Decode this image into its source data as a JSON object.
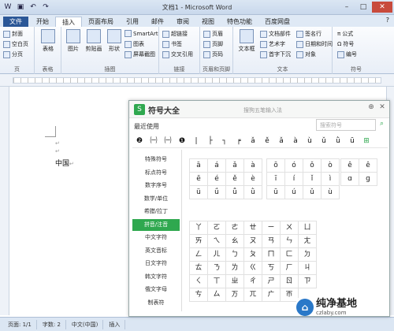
{
  "window": {
    "title": "文档1 - Microsoft Word"
  },
  "ribbon_tabs": [
    "文件",
    "开始",
    "插入",
    "页面布局",
    "引用",
    "邮件",
    "审阅",
    "视图",
    "特色功能",
    "百度网盘"
  ],
  "ribbon": {
    "groups": {
      "pages": "页",
      "table": "表格",
      "illus": "插图",
      "links": "链接",
      "hf": "页眉和页脚",
      "text": "文本",
      "symbols": "符号"
    },
    "cover": "封面",
    "blank": "空白页",
    "break": "分页",
    "table": "表格",
    "picture": "图片",
    "clipart": "剪贴画",
    "shapes": "形状",
    "smartart": "SmartArt",
    "chart": "图表",
    "screenshot": "屏幕截图",
    "hyperlink": "超链接",
    "bookmark": "书签",
    "crossref": "交叉引用",
    "header": "页眉",
    "footer": "页脚",
    "pagenum": "页码",
    "textbox": "文本框",
    "parts": "文档部件",
    "wordart": "艺术字",
    "dropcap": "首字下沉",
    "sigline": "签名行",
    "datetime": "日期和时间",
    "object": "对象",
    "equation": "公式",
    "symbol": "符号",
    "number": "编号"
  },
  "document": {
    "text": "中国"
  },
  "status": {
    "page": "页面: 1/1",
    "words": "字数: 2",
    "lang": "中文(中国)",
    "mode": "插入"
  },
  "panel": {
    "title": "符号大全",
    "subtitle": "搜狗五笔输入法",
    "recent_label": "最近使用",
    "search_placeholder": "搜索符号",
    "recent": [
      "❷",
      "㈠",
      "㈠",
      "❶",
      "|",
      "├",
      "┐",
      "╒",
      "ǎ",
      "ě",
      "ǎ",
      "à",
      "ù",
      "ǔ",
      "ǜ",
      "ū"
    ],
    "categories": [
      "特殊符号",
      "标点符号",
      "数字序号",
      "数学/单位",
      "希腊/拉丁",
      "拼音/注音",
      "中文字符",
      "英文音标",
      "日文字符",
      "韩文字符",
      "俄文字母",
      "制表符"
    ],
    "active_category": "拼音/注音",
    "pinyin_a": [
      "ā",
      "á",
      "ǎ",
      "à",
      "ē",
      "é",
      "ě",
      "è",
      "ü",
      "ǘ",
      "ǚ",
      "ǜ"
    ],
    "pinyin_o": [
      "ō",
      "ó",
      "ǒ",
      "ò",
      "ī",
      "í",
      "ǐ",
      "ì",
      "ū",
      "ú",
      "ǔ",
      "ù"
    ],
    "pinyin_e": [
      "ê",
      "ê",
      "ɑ",
      "ɡ"
    ],
    "zhuyin": [
      "丫",
      "ㄛ",
      "ㄜ",
      "ㄝ",
      "ㄧ",
      "ㄨ",
      "ㄩ",
      "ㄞ",
      "ㄟ",
      "ㄠ",
      "ㄡ",
      "ㄢ",
      "ㄣ",
      "ㄤ",
      "ㄥ",
      "ㄦ",
      "ㄅ",
      "ㄆ",
      "ㄇ",
      "ㄈ",
      "ㄉ",
      "ㄊ",
      "ㄋ",
      "ㄌ",
      "ㄍ",
      "ㄎ",
      "ㄏ",
      "ㄐ",
      "ㄑ",
      "ㄒ",
      "ㄓ",
      "ㄔ",
      "ㄕ",
      "ㄖ",
      "ㄗ",
      "ㄘ",
      "ㄙ",
      "ㄪ",
      "ㄫ",
      "ㄬ",
      "ㄭ"
    ]
  },
  "watermark": {
    "main": "纯净基地",
    "sub": "czlaby.com"
  }
}
